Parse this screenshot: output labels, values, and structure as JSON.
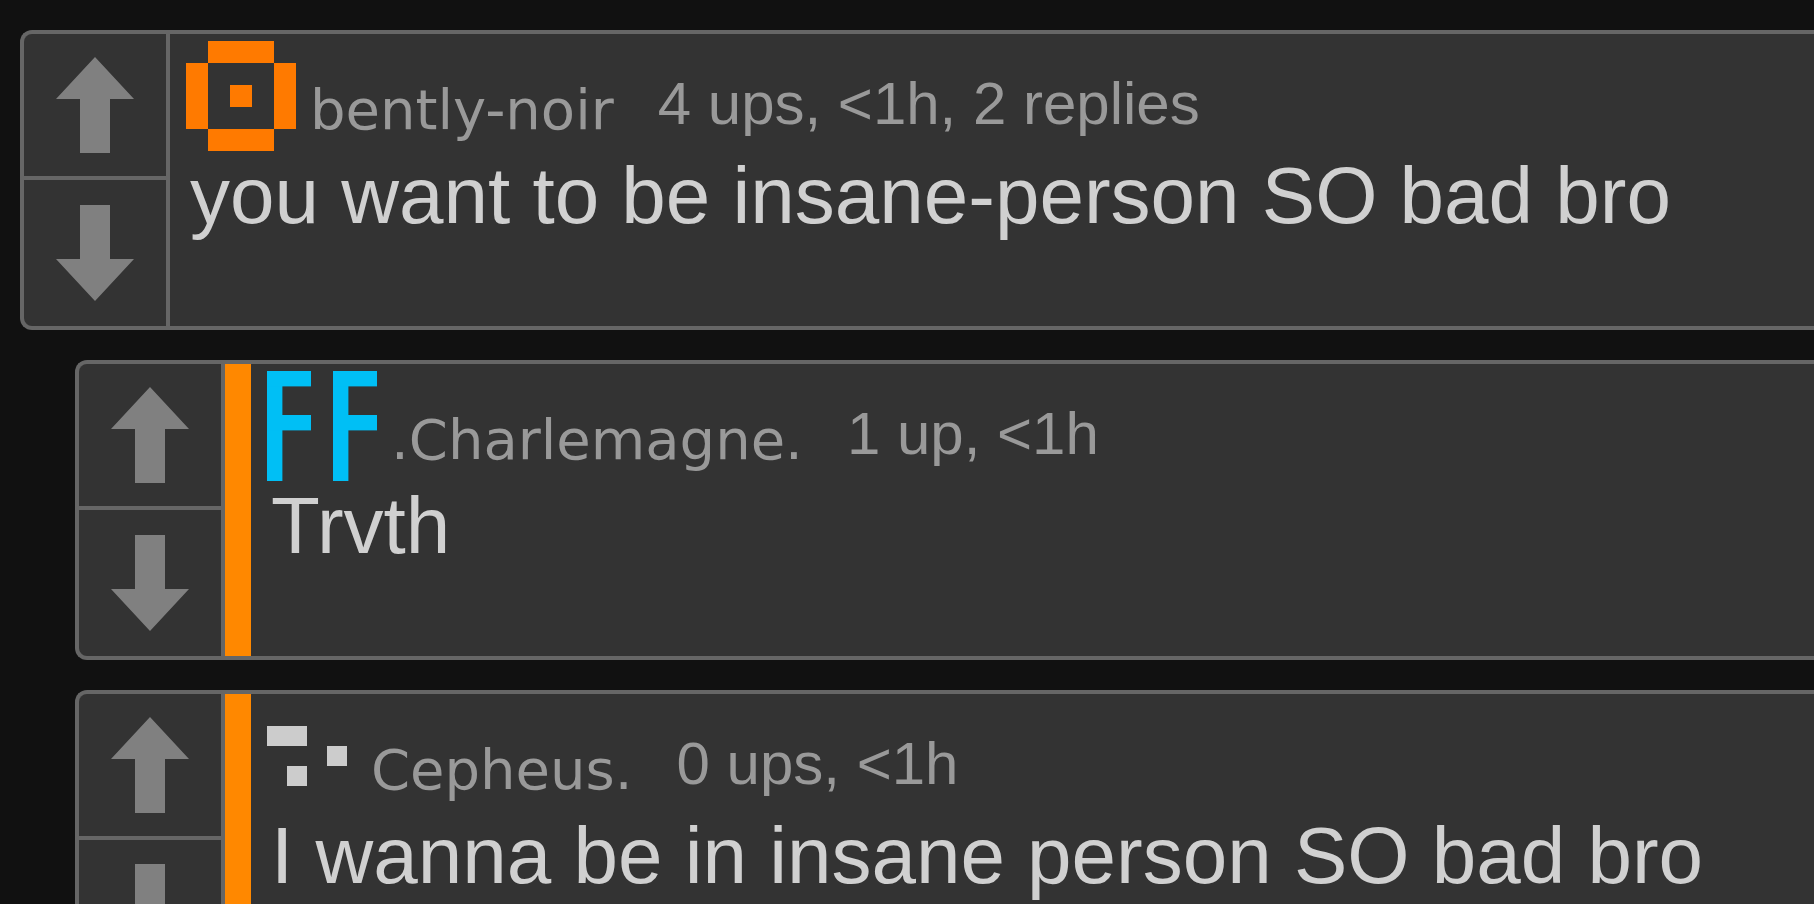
{
  "comments": [
    {
      "username": "bently-noir",
      "meta": "4 ups, <1h, 2 replies",
      "text": "you want to be insane-person SO bad bro",
      "kind": "ring",
      "children": [
        {
          "username": ".Charlemagne.",
          "meta": "1 up, <1h",
          "text": "Trvth",
          "kind": "letters"
        },
        {
          "username": "Cepheus.",
          "meta": "0 ups, <1h",
          "text": "I wanna be in insane person SO bad bro",
          "kind": "dots"
        }
      ]
    }
  ]
}
